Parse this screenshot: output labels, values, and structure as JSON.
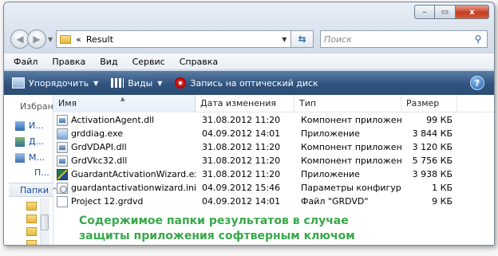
{
  "window": {
    "caption_buttons": {
      "minimize": "–",
      "maximize": "▭",
      "close": "x"
    }
  },
  "address": {
    "prefix": "«",
    "path": "Result",
    "search_placeholder": "Поиск"
  },
  "menubar": {
    "items": [
      "Файл",
      "Правка",
      "Вид",
      "Сервис",
      "Справка"
    ]
  },
  "toolbar": {
    "organize": "Упорядочить",
    "views": "Виды",
    "burn": "Запись на оптический диск",
    "help": "?"
  },
  "nav_pane": {
    "favorites_header": "Избранн",
    "items": [
      "И...",
      "Д...",
      "М..."
    ],
    "more": "П...",
    "folders": "Папки"
  },
  "columns": {
    "name": "Имя",
    "date": "Дата изменения",
    "type": "Тип",
    "size": "Размер"
  },
  "files": [
    {
      "name": "ActivationAgent.dll",
      "date": "31.08.2012 11:20",
      "type": "Компонент приложения",
      "size": "99 КБ",
      "icon": "dll-icon"
    },
    {
      "name": "grddiag.exe",
      "date": "04.09.2012 14:01",
      "type": "Приложение",
      "size": "3 844 КБ",
      "icon": "exe-icon"
    },
    {
      "name": "GrdVDAPI.dll",
      "date": "31.08.2012 11:20",
      "type": "Компонент приложения",
      "size": "3 120 КБ",
      "icon": "dll-icon"
    },
    {
      "name": "GrdVkc32.dll",
      "date": "31.08.2012 11:20",
      "type": "Компонент приложения",
      "size": "5 756 КБ",
      "icon": "dll-icon"
    },
    {
      "name": "GuardantActivationWizard.exe",
      "date": "31.08.2012 11:20",
      "type": "Приложение",
      "size": "3 938 КБ",
      "icon": "shield-icon"
    },
    {
      "name": "guardantactivationwizard.ini",
      "date": "04.09.2012 15:46",
      "type": "Параметры конфигура...",
      "size": "1 КБ",
      "icon": "ini-icon"
    },
    {
      "name": "Project 12.grdvd",
      "date": "04.09.2012 14:01",
      "type": "Файл \"GRDVD\"",
      "size": "9 КБ",
      "icon": "file-icon"
    }
  ],
  "caption": {
    "line1": "Содержимое папки результатов в случае",
    "line2": "защиты приложения софтверным ключом"
  },
  "colors": {
    "caption_text": "#38a84a",
    "toolbar_bg": "#30547f",
    "close_button": "#c23c1e"
  }
}
